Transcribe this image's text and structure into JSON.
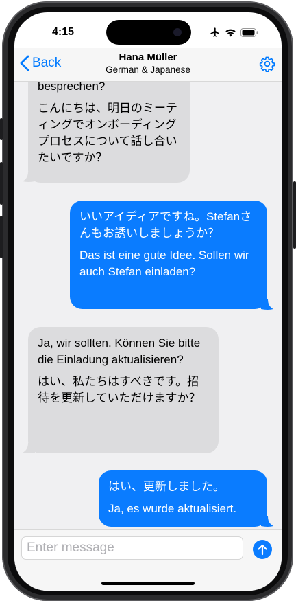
{
  "status": {
    "time": "4:15"
  },
  "nav": {
    "back_label": "Back",
    "title": "Hana Müller",
    "subtitle": "German & Japanese"
  },
  "messages": [
    {
      "direction": "incoming",
      "lines": [
        "besprechen?",
        "こんにちは、明日のミーティングでオンボーディングプロセスについて話し合いたいですか？"
      ]
    },
    {
      "direction": "outgoing",
      "lines": [
        "いいアイディアですね。Stefanさんもお誘いしましょうか？",
        "Das ist eine gute Idee. Sollen wir auch Stefan einladen?"
      ]
    },
    {
      "direction": "incoming",
      "lines": [
        "Ja, wir sollten. Können Sie bitte die Einladung aktualisieren?",
        "はい、私たちはすべきです。招待を更新していただけますか？"
      ]
    },
    {
      "direction": "outgoing",
      "lines": [
        "はい、更新しました。",
        "Ja, es wurde aktualisiert."
      ]
    }
  ],
  "composer": {
    "placeholder": "Enter message",
    "value": ""
  },
  "colors": {
    "accent": "#007aff",
    "outgoing_bubble": "#0a7cff",
    "incoming_bubble": "#dcdcde"
  },
  "icons": {
    "back": "chevron-left-icon",
    "settings": "gear-icon",
    "send": "arrow-up-icon",
    "status": [
      "airplane-icon",
      "wifi-icon",
      "battery-icon"
    ]
  }
}
